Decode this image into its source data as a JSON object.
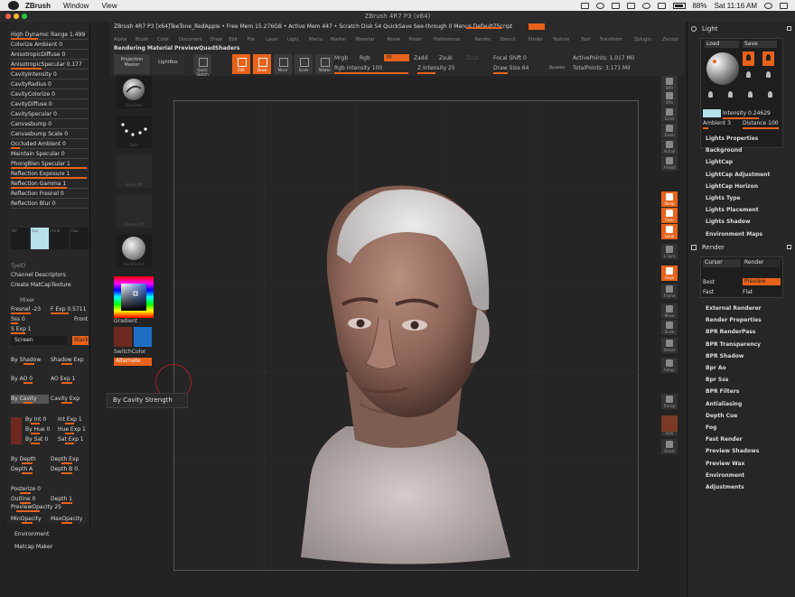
{
  "macbar": {
    "app": "ZBrush",
    "menus": [
      "Window",
      "View"
    ],
    "battery": "88%",
    "clock": "Sat 11:16 AM"
  },
  "window": {
    "title": "ZBrush 4R7 P3 (x64)",
    "infoline": "ZBrush 4R7 P3 [x64]TeeTone_RedApple   • Free Mem 15.276GB • Active Mem 447 • Scratch Disk 54   QuickSave   See-through 0   Menus   DefaultZScript"
  },
  "topmenu": [
    "Alpha",
    "Brush",
    "Color",
    "Document",
    "Draw",
    "Edit",
    "File",
    "Layer",
    "Light",
    "Macro",
    "Marker",
    "Material",
    "Movie",
    "Picker",
    "Preferences",
    "Render",
    "Stencil",
    "Stroke",
    "Texture",
    "Tool",
    "Transform",
    "Zplugin",
    "Zscript"
  ],
  "toppalette": {
    "title": "Rendering Material PreviewQuadShaders",
    "projection_master": "Projection Master",
    "lightbox": "LightBox",
    "quick_sketch": "Quick Sketch",
    "edit": "Edit",
    "draw": "Draw",
    "move": "Move",
    "scale": "Scale",
    "rotate": "Rotate",
    "mrgb": "Mrgb",
    "rgb": "Rgb",
    "m": "M",
    "rgb_intensity": "Rgb Intensity 100",
    "zadd": "Zadd",
    "zsub": "Zsub",
    "zcut": "Zcut",
    "z_intensity": "Z Intensity 25",
    "focal_shift": "Focal Shift 0",
    "draw_size": "Draw Size 64",
    "dynamic": "Dynamic",
    "active_points": "ActivePoints: 1.017 Mil",
    "total_points": "TotalPoints: 3.171 Mil"
  },
  "leftpanel": {
    "rows": [
      "High Dynamic Range 1.499",
      "Colorize Ambient 0",
      "AnisotropicDiffuse 0",
      "AnisotropicSpecular 0.177",
      "CavityIntensity 0",
      "CavityRadius 0",
      "CavityColorize 0",
      "CavityDiffuse 0",
      "CavitySpecular 0",
      "Canvasbump 0",
      "Canvasbump Scale 0",
      "Occluded Ambient 0",
      "Maintain Specular 0",
      "PhongBlen Specular 1",
      "Reflection Exposure 1",
      "Reflection Gamma 1",
      "Reflection Fresnel 0",
      "Reflection Blur 0"
    ],
    "matcells": [
      "Dif",
      "Spe",
      "Amb",
      "Cav"
    ],
    "tyeid": "TyeID",
    "channel_descriptors": "Channel Descriptors",
    "create_matcap": "Create MatCapTexture",
    "mixer": "Mixer",
    "fresnel": "Fresnel -23",
    "f_exp": "F Exp 0.5711",
    "sss": "Sss 0",
    "front": "Front",
    "s_exp": "S Exp 1",
    "screen": "Screen",
    "black": "Black",
    "by_shadow": "By Shadow",
    "shadow_exp": "Shadow Exp",
    "by_ao": "By AO 0",
    "ao_exp": "AO Exp 1",
    "by_cavity": "By Cavity",
    "cavity_exp": "Cavity Exp",
    "by_int": "By Int 0",
    "int_exp": "Int Exp 1",
    "by_hue": "By Hue 0",
    "hue_exp": "Hue Exp 1",
    "by_sat": "By Sat 0",
    "sat_exp": "Sat Exp 1",
    "by_depth": "By Depth",
    "depth_exp": "Depth Exp",
    "depth_a": "Depth A",
    "depth_b": "Depth B 0.",
    "posterize": "Posterize 0",
    "outline": "Outline 0",
    "outline_depth": "Depth 1",
    "minopacity": "MinOpacity",
    "maxopacity": "MaxOpacity",
    "preview_opacity": "PreviewOpacity 25",
    "environment": "Environment",
    "matcap_maker": "Matcap Maker"
  },
  "toolcol": {
    "labels": [
      "Standard",
      "Dots",
      "Alpha Off",
      "Texture Off",
      "SkinShade4"
    ],
    "gradient": "Gradient",
    "switchcolor": "SwitchColor",
    "alternate": "Alternate"
  },
  "tooltip": "By Cavity Strength",
  "rightshelf": {
    "labels": [
      "BPR",
      "SPix",
      "Scroll",
      "Zoom",
      "Actual",
      "AAHalf",
      "Persp",
      "Floor",
      "Local",
      "L.Sym",
      "Gxyz",
      "Frame",
      "Move",
      "Scale",
      "Rotate",
      "Setup",
      "Transp",
      "Solo",
      "Ghost"
    ]
  },
  "rightpanel": {
    "light": "Light",
    "load": "Load",
    "save": "Save",
    "intensity": "Intensity 0.24629",
    "ambient": "Ambient 3",
    "distance": "Distance 100",
    "light_list": [
      "Lights Properties",
      "Background",
      "LightCap",
      "LightCap Adjustment",
      "LightCap Horizon",
      "Lights Type",
      "Lights Placement",
      "Lights Shadow",
      "Environment Maps"
    ],
    "render": "Render",
    "cursor": "Cursor",
    "render_btn": "Render",
    "best": "Best",
    "preview": "Preview",
    "fast": "Fast",
    "flat": "Flat",
    "render_list": [
      "External Renderer",
      "Render Properties",
      "BPR RenderPass",
      "BPR Transparency",
      "BPR Shadow",
      "Bpr Ao",
      "Bpr Sss",
      "BPR Filters",
      "Antialiasing",
      "Depth Cue",
      "Fog",
      "Fast Render",
      "Preview Shadows",
      "Preview Wax",
      "Environment",
      "Adjustments"
    ]
  },
  "colors": {
    "accent": "#e8621a",
    "panel": "#262626",
    "canvas": "#252525"
  }
}
